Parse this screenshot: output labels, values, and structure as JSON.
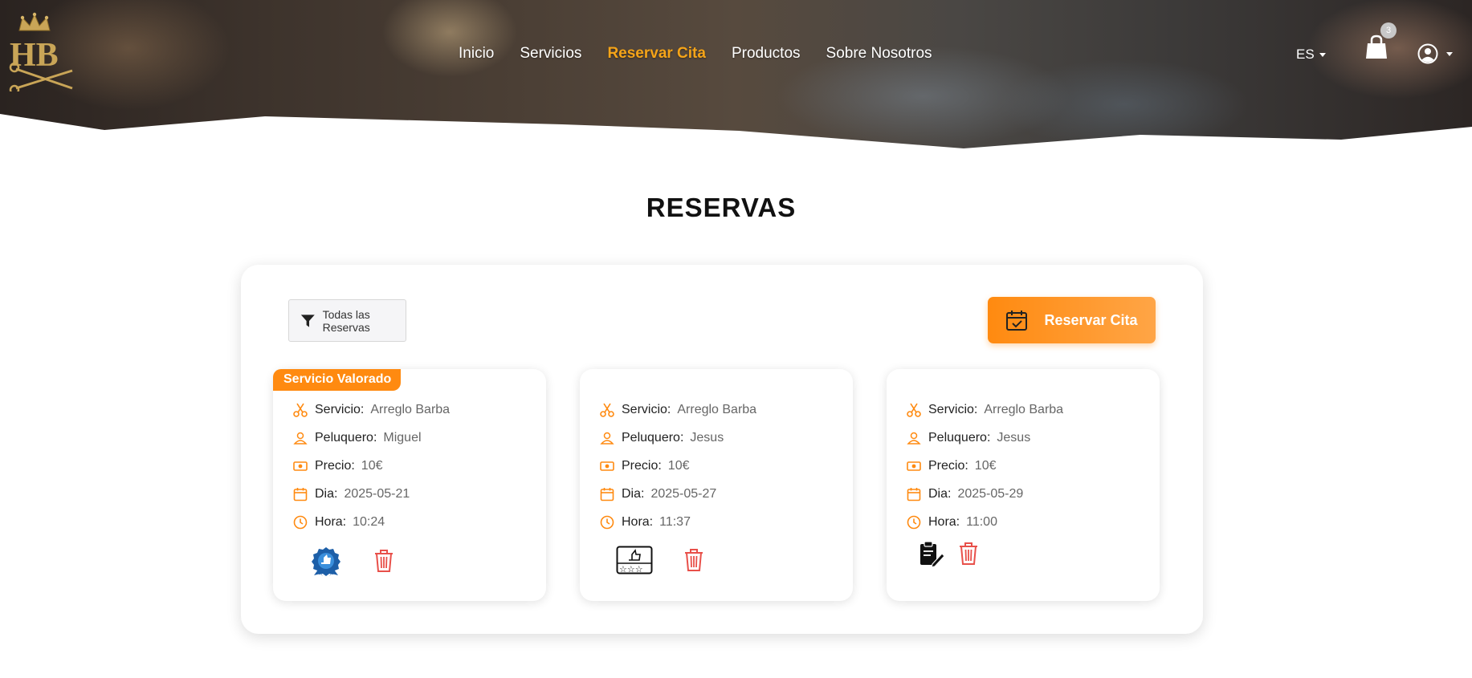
{
  "header": {
    "logo_text": "HB",
    "nav": [
      {
        "label": "Inicio",
        "active": false
      },
      {
        "label": "Servicios",
        "active": false
      },
      {
        "label": "Reservar Cita",
        "active": true
      },
      {
        "label": "Productos",
        "active": false
      },
      {
        "label": "Sobre Nosotros",
        "active": false
      }
    ],
    "language": "ES",
    "cart_count": "3",
    "icons": {
      "cart": "shopping-bag-icon",
      "user": "user-circle-icon"
    }
  },
  "page_title": "RESERVAS",
  "toolbar": {
    "filter_label": "Todas las Reservas",
    "book_label": "Reservar Cita"
  },
  "colors": {
    "accent": "#ff8a10",
    "nav_active": "#f5a418",
    "delete": "#e8504a"
  },
  "labels": {
    "service": "Servicio:",
    "barber": "Peluquero:",
    "price": "Precio:",
    "day": "Dia:",
    "time": "Hora:"
  },
  "reservations": [
    {
      "badge": "Servicio Valorado",
      "service": "Arreglo Barba",
      "barber": "Miguel",
      "price": "10€",
      "day": "2025-05-21",
      "time": "10:24",
      "action_icon": "rated-badge-icon"
    },
    {
      "badge": "",
      "service": "Arreglo Barba",
      "barber": "Jesus",
      "price": "10€",
      "day": "2025-05-27",
      "time": "11:37",
      "action_icon": "rate-service-icon"
    },
    {
      "badge": "",
      "service": "Arreglo Barba",
      "barber": "Jesus",
      "price": "10€",
      "day": "2025-05-29",
      "time": "11:00",
      "action_icon": "edit-clipboard-icon"
    }
  ]
}
